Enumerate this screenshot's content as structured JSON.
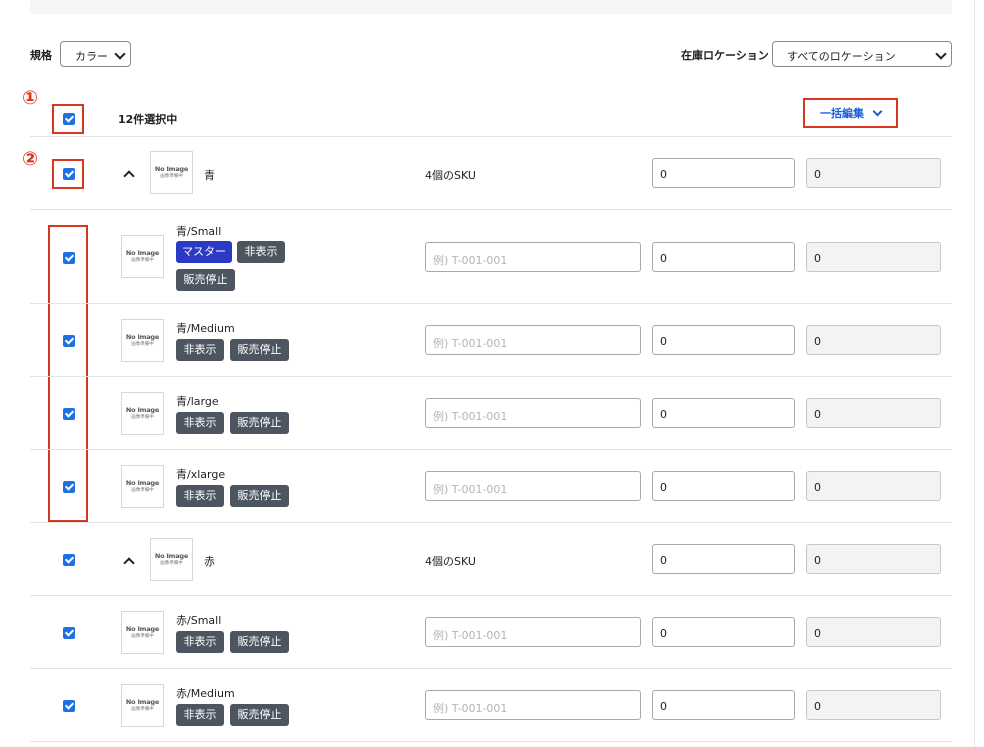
{
  "filters": {
    "spec_label": "規格",
    "spec_value": "カラー",
    "location_label": "在庫ロケーション",
    "location_value": "すべてのロケーション"
  },
  "annotations": {
    "one": "①",
    "two": "②"
  },
  "selection": {
    "count_text": "12件選択中"
  },
  "bulk_edit": {
    "label": "一括編集"
  },
  "thumbnail": {
    "line1": "No Image",
    "line2": "画像準備中"
  },
  "sku_placeholder": "例) T-001-001",
  "groups": [
    {
      "name": "青",
      "sku_count": "4個のSKU",
      "qty": "0",
      "stock": "0"
    },
    {
      "name": "赤",
      "sku_count": "4個のSKU",
      "qty": "0",
      "stock": "0"
    }
  ],
  "variants": [
    {
      "name": "青/Small",
      "tags": [
        "マスター",
        "非表示",
        "販売停止"
      ],
      "qty": "0",
      "stock": "0"
    },
    {
      "name": "青/Medium",
      "tags": [
        "非表示",
        "販売停止"
      ],
      "qty": "0",
      "stock": "0"
    },
    {
      "name": "青/large",
      "tags": [
        "非表示",
        "販売停止"
      ],
      "qty": "0",
      "stock": "0"
    },
    {
      "name": "青/xlarge",
      "tags": [
        "非表示",
        "販売停止"
      ],
      "qty": "0",
      "stock": "0"
    },
    {
      "name": "赤/Small",
      "tags": [
        "非表示",
        "販売停止"
      ],
      "qty": "0",
      "stock": "0"
    },
    {
      "name": "赤/Medium",
      "tags": [
        "非表示",
        "販売停止"
      ],
      "qty": "0",
      "stock": "0"
    }
  ],
  "colors": {
    "accent": "#1f6fe5",
    "annotation": "#d7371f",
    "master_tag": "#2b39c4",
    "tag": "#4d5560"
  }
}
